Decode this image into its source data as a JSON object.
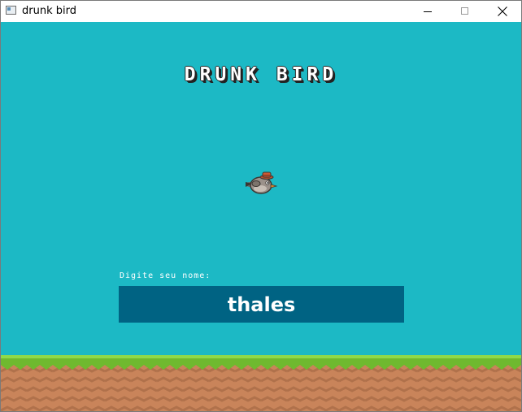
{
  "window": {
    "title": "drunk bird"
  },
  "game": {
    "title": "DRUNK BIRD",
    "prompt_label": "Digite seu nome:",
    "name_value": "thales",
    "colors": {
      "sky": "#1cb9c5",
      "input_bg": "#006383",
      "grass": "#7fc63d",
      "dirt": "#c9845a"
    }
  }
}
